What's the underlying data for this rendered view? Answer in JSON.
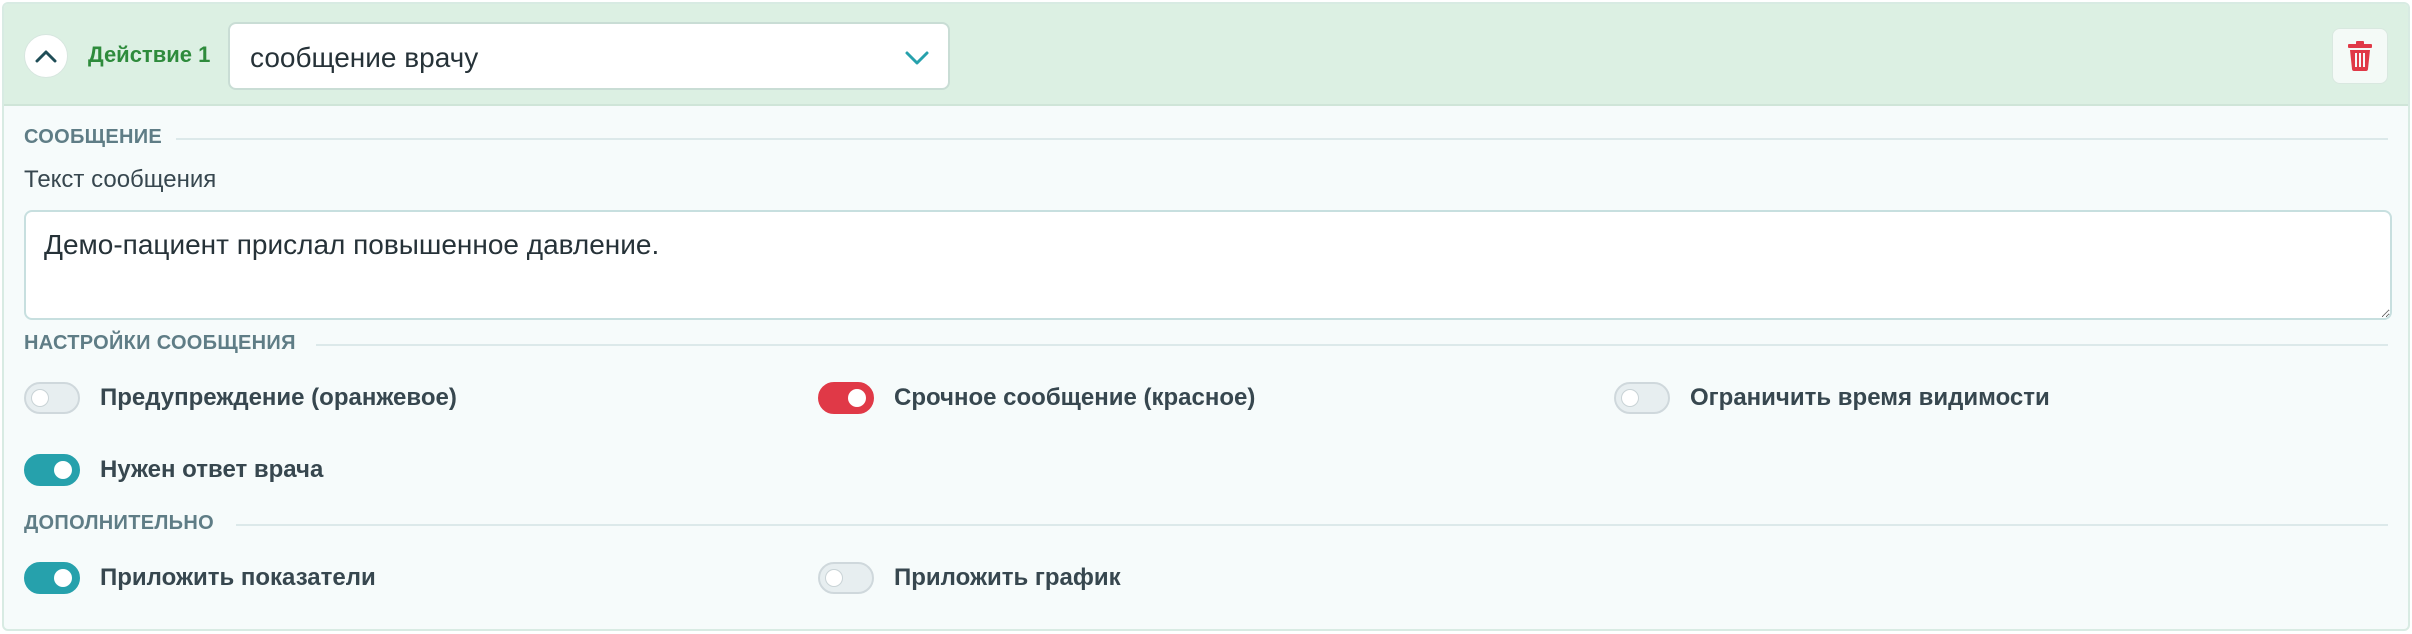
{
  "header": {
    "action_label": "Действие 1",
    "action_type_value": "сообщение врачу",
    "collapse_icon": "chevron-up-icon",
    "select_icon": "chevron-down-icon",
    "delete_icon": "trash-icon"
  },
  "message_section": {
    "title": "СООБЩЕНИЕ",
    "text_label": "Текст сообщения",
    "text_value": "Демо-пациент прислал повышенное давление."
  },
  "settings_section": {
    "title": "НАСТРОЙКИ СООБЩЕНИЯ",
    "toggles": [
      {
        "label": "Предупреждение (оранжевое)",
        "on": false
      },
      {
        "label": "Срочное сообщение (красное)",
        "on": true
      },
      {
        "label": "Ограничить время видимости",
        "on": false
      },
      {
        "label": "Нужен ответ врача",
        "on": true
      }
    ]
  },
  "extra_section": {
    "title": "ДОПОЛНИТЕЛЬНО",
    "toggles": [
      {
        "label": "Приложить показатели",
        "on": true
      },
      {
        "label": "Приложить график",
        "on": false
      }
    ]
  },
  "colors": {
    "header_bg": "#dcf0e3",
    "accent_green": "#2e8b3c",
    "toggle_teal": "#26a1ac",
    "toggle_red": "#e03947",
    "delete_red": "#e03947"
  }
}
